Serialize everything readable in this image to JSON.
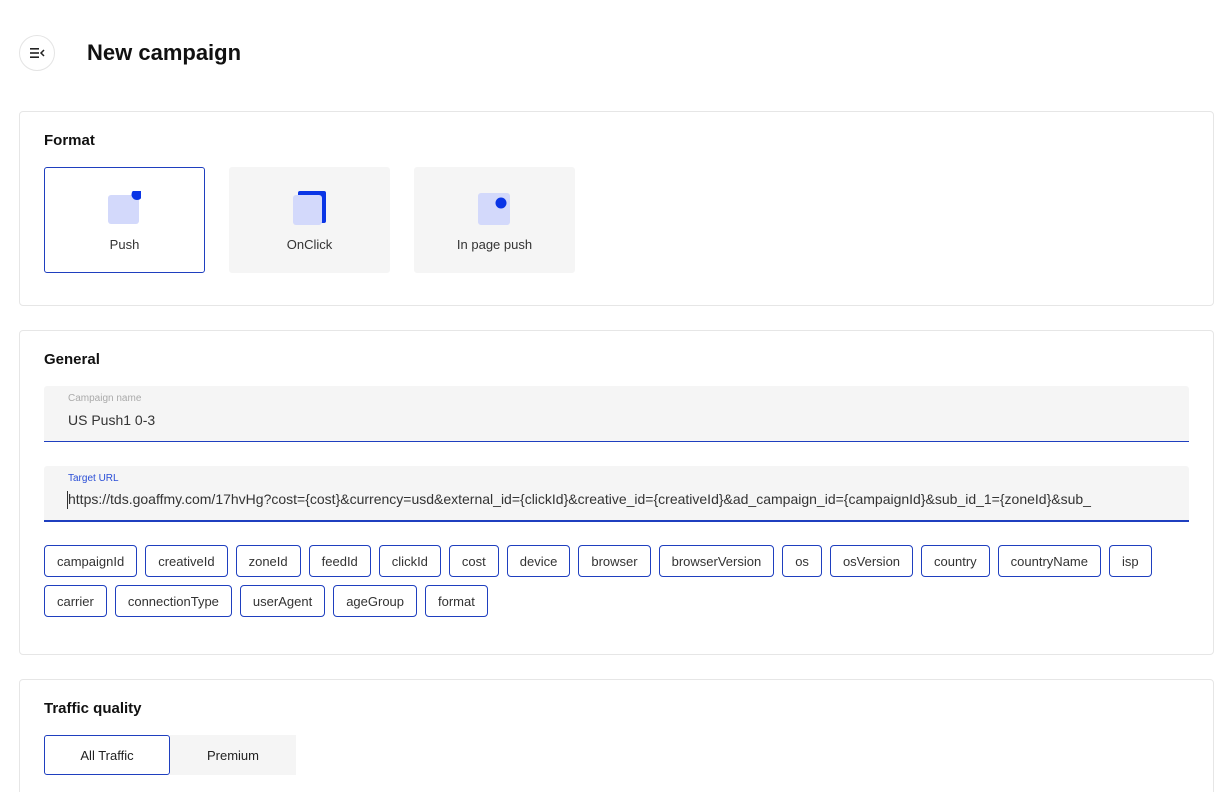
{
  "header": {
    "menu_icon": "menu-collapse-icon",
    "title": "New campaign"
  },
  "format": {
    "title": "Format",
    "options": [
      {
        "label": "Push",
        "icon": "push-format-icon",
        "selected": true
      },
      {
        "label": "OnClick",
        "icon": "onclick-format-icon",
        "selected": false
      },
      {
        "label": "In page push",
        "icon": "in-page-push-format-icon",
        "selected": false
      }
    ]
  },
  "general": {
    "title": "General",
    "campaign_name": {
      "label": "Campaign name",
      "value": "US Push1 0-3"
    },
    "target_url": {
      "label": "Target URL",
      "value": "https://tds.goaffmy.com/17hvHg?cost={cost}&currency=usd&external_id={clickId}&creative_id={creativeId}&ad_campaign_id={campaignId}&sub_id_1={zoneId}&sub_"
    },
    "macros_row1": [
      "campaignId",
      "creativeId",
      "zoneId",
      "feedId",
      "clickId",
      "cost",
      "device",
      "browser",
      "browserVersion",
      "os",
      "osVersion",
      "country",
      "countryName",
      "isp"
    ],
    "macros_row2": [
      "carrier",
      "connectionType",
      "userAgent",
      "ageGroup",
      "format"
    ]
  },
  "traffic_quality": {
    "title": "Traffic quality",
    "options": [
      {
        "label": "All Traffic",
        "selected": true
      },
      {
        "label": "Premium",
        "selected": false
      }
    ]
  },
  "colors": {
    "accent": "#1f3fbf",
    "icon_fill": "#d3d9fb",
    "icon_dot": "#0a35e6",
    "tile_bg": "#f5f5f5"
  }
}
